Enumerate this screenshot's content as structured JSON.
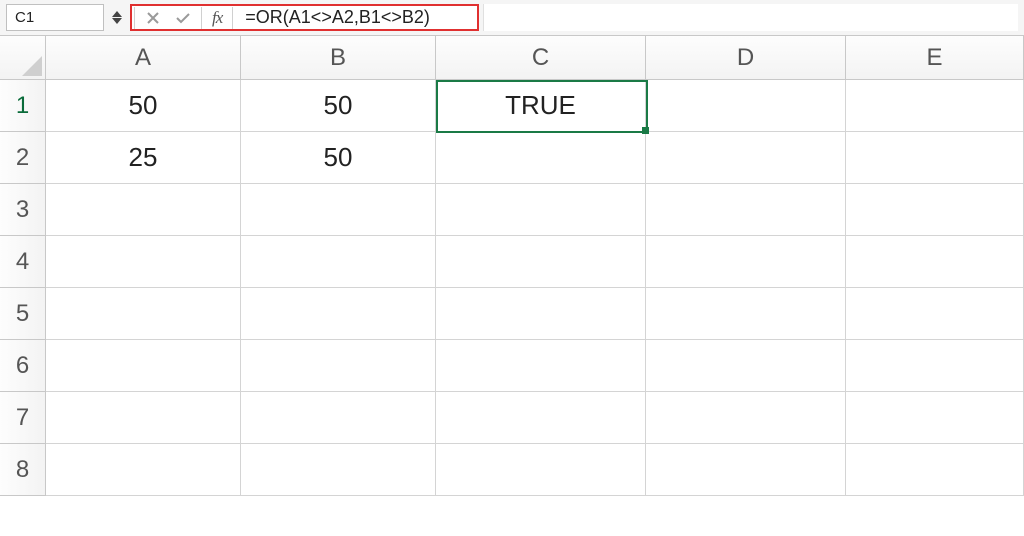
{
  "formula_bar": {
    "name_box": "C1",
    "formula": "=OR(A1<>A2,B1<>B2)",
    "fx_label": "fx"
  },
  "columns": [
    "A",
    "B",
    "C",
    "D",
    "E"
  ],
  "rows": [
    "1",
    "2",
    "3",
    "4",
    "5",
    "6",
    "7",
    "8"
  ],
  "cells": {
    "A1": "50",
    "B1": "50",
    "C1": "TRUE",
    "A2": "25",
    "B2": "50"
  },
  "selection": {
    "address": "C1"
  },
  "chart_data": {
    "type": "table",
    "headers": [
      "",
      "A",
      "B",
      "C"
    ],
    "rows": [
      [
        "1",
        "50",
        "50",
        "TRUE"
      ],
      [
        "2",
        "25",
        "50",
        ""
      ]
    ],
    "formula_cell": {
      "address": "C1",
      "formula": "=OR(A1<>A2,B1<>B2)",
      "result": "TRUE"
    }
  }
}
